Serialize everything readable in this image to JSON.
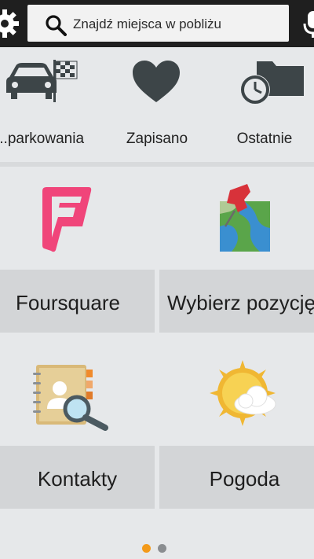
{
  "topbar": {
    "search_placeholder": "Znajdź miejsca w pobliżu"
  },
  "shortcuts": [
    {
      "label": "...parkowania",
      "icon": "car-flag-icon"
    },
    {
      "label": "Zapisano",
      "icon": "heart-icon"
    },
    {
      "label": "Ostatnie",
      "icon": "clock-folder-icon"
    }
  ],
  "tiles": [
    {
      "label": "Foursquare",
      "icon": "foursquare-icon"
    },
    {
      "label": "Wybierz pozycję",
      "icon": "map-pin-icon"
    },
    {
      "label": "Kontakty",
      "icon": "address-book-icon"
    },
    {
      "label": "Pogoda",
      "icon": "weather-sun-cloud-icon"
    }
  ],
  "pager": {
    "current": 1,
    "total": 2
  },
  "colors": {
    "topbar": "#1f1f1f",
    "accent_dot": "#f39a1a",
    "inactive_dot": "#8a8d90",
    "icon_dark": "#3d4548",
    "foursquare_pink": "#f0457a"
  }
}
